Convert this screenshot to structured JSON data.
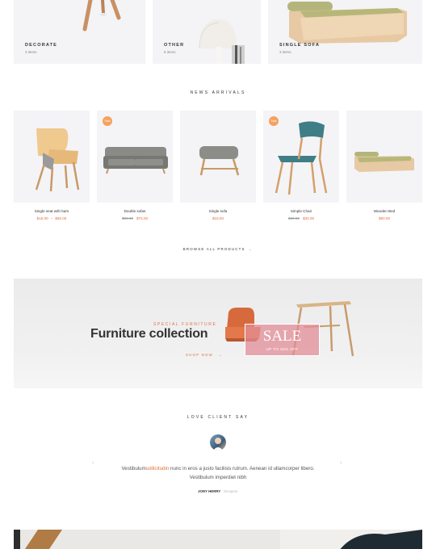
{
  "categories": [
    {
      "title": "DECORATE",
      "count": "3 items"
    },
    {
      "title": "OTHER",
      "count": "6 items"
    },
    {
      "title": "SINGLE SOFA",
      "count": "3 items"
    }
  ],
  "new_arrivals": {
    "heading": "NEWS ARRIVALS",
    "products": [
      {
        "name": "Single seat with bars",
        "price": "$18.00",
        "price_to": "$65.00",
        "badge": ""
      },
      {
        "name": "Double sofas",
        "old_price": "$80.00",
        "price": "$75.00",
        "badge": "Sale"
      },
      {
        "name": "Single sofa",
        "price": "$18.00",
        "badge": ""
      },
      {
        "name": "Simple Chair",
        "old_price": "$30.00",
        "price": "$30.00",
        "badge": "Sale"
      },
      {
        "name": "Wooden Bed",
        "price": "$90.00",
        "badge": ""
      }
    ],
    "browse_label": "BROWSE ALL PRODUCTS",
    "browse_arrow": "→"
  },
  "banner": {
    "eyebrow": "SPECIAL FURNITURE",
    "headline": "Furniture collection",
    "shop_label": "SHOP NOW",
    "shop_arrow": "→",
    "sale_title": "SALE",
    "sale_sub": "UP TO 30% OFF"
  },
  "testimonials": {
    "heading": "LOVE CLIENT SAY",
    "quote_before": "Vestibulum",
    "quote_highlight": "sollicitudin",
    "quote_after": " nunc in eros a justo facilisis rutrum. Aenean id ullamcorper libero. Vestibulum imperdiet nibh",
    "author": "JONY HERRY",
    "role": "Designer",
    "prev_arrow": "‹",
    "next_arrow": "›"
  },
  "colors": {
    "accent": "#e0703d",
    "badge": "#f5a25d",
    "card_bg": "#f4f4f7"
  }
}
